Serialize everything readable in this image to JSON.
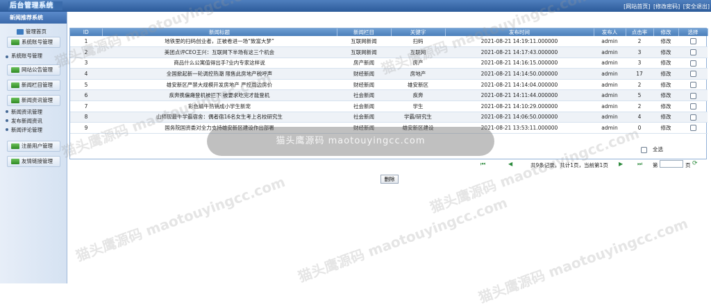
{
  "header": {
    "logo": "后台管理系统",
    "links": [
      "[网站首页]",
      "[修改密码]",
      "[安全退出]"
    ]
  },
  "sidebar": {
    "title": "新闻推荐系统",
    "items": [
      {
        "label": "管理首页"
      },
      {
        "label": "系统账号管理"
      },
      {
        "label": "系统账号管理"
      },
      {
        "label": "网站公告管理"
      },
      {
        "label": "新闻栏目管理"
      },
      {
        "label": "新闻资讯管理"
      },
      {
        "label": "新闻资讯管理"
      },
      {
        "label": "发布新闻资讯"
      },
      {
        "label": "新闻评论管理"
      },
      {
        "label": "注册用户管理"
      },
      {
        "label": "友情链接管理"
      }
    ]
  },
  "table": {
    "headers": [
      "ID",
      "新闻标题",
      "新闻栏目",
      "关键字",
      "发布时间",
      "发布人",
      "点击率",
      "修改",
      "选择"
    ],
    "rows": [
      {
        "id": "1",
        "title": "地铁里的扫码创业者，正被卷进一场“致富大梦”",
        "column": "互联网新闻",
        "keyword": "扫码",
        "time": "2021-08-21 14:19:11.000000",
        "author": "admin",
        "clicks": "2",
        "edit": "修改"
      },
      {
        "id": "2",
        "title": "美团点评CEO王兴：互联网下半场有这三个机会",
        "column": "互联网新闻",
        "keyword": "互联网",
        "time": "2021-08-21 14:17:43.000000",
        "author": "admin",
        "clicks": "3",
        "edit": "修改"
      },
      {
        "id": "3",
        "title": "商品什么公寓值得出手?业内专家这样说",
        "column": "房产新闻",
        "keyword": "房产",
        "time": "2021-08-21 14:16:15.000000",
        "author": "admin",
        "clicks": "3",
        "edit": "修改"
      },
      {
        "id": "4",
        "title": "全国掀起新一轮调控热潮 限售此房地产税呼声",
        "column": "财经新闻",
        "keyword": "房地产",
        "time": "2021-08-21 14:14:50.000000",
        "author": "admin",
        "clicks": "17",
        "edit": "修改"
      },
      {
        "id": "5",
        "title": "雄安新区严禁大规模开发房地产 严控周边房价",
        "column": "财经新闻",
        "keyword": "雄安新区",
        "time": "2021-08-21 14:14:04.000000",
        "author": "admin",
        "clicks": "2",
        "edit": "修改"
      },
      {
        "id": "6",
        "title": "疾奔携偏瘫登机被拦下 被要求吃完才能登机",
        "column": "社会新闻",
        "keyword": "疾奔",
        "time": "2021-08-21 14:11:44.000000",
        "author": "admin",
        "clicks": "5",
        "edit": "修改"
      },
      {
        "id": "7",
        "title": "彩色蜻牛热销成小学生新宠",
        "column": "社会新闻",
        "keyword": "学生",
        "time": "2021-08-21 14:10:29.000000",
        "author": "admin",
        "clicks": "2",
        "edit": "修改"
      },
      {
        "id": "8",
        "title": "山师现最牛学霸宿舍：偶者宿16名女生考上名校研究生",
        "column": "社会新闻",
        "keyword": "学霸/研究生",
        "time": "2021-08-21 14:06:50.000000",
        "author": "admin",
        "clicks": "4",
        "edit": "修改"
      },
      {
        "id": "9",
        "title": "国务院国资委对全力支持雄安新区建设作出部署",
        "column": "财经新闻",
        "keyword": "雄安新区建设",
        "time": "2021-08-21 13:53:11.000000",
        "author": "admin",
        "clicks": "0",
        "edit": "修改"
      }
    ],
    "select_all": "全选"
  },
  "pager": {
    "summary": "共9条记录，共计1页，当前第1页",
    "goto_prefix": "第",
    "goto_suffix": "页",
    "first": "⏮",
    "prev": "◀",
    "next": "▶",
    "last": "⏭"
  },
  "delete_button": "删除",
  "toast": "猫头鹰源码 maotouyingcc.com",
  "watermark": "猫头鹰源码 maotouyingcc.com"
}
